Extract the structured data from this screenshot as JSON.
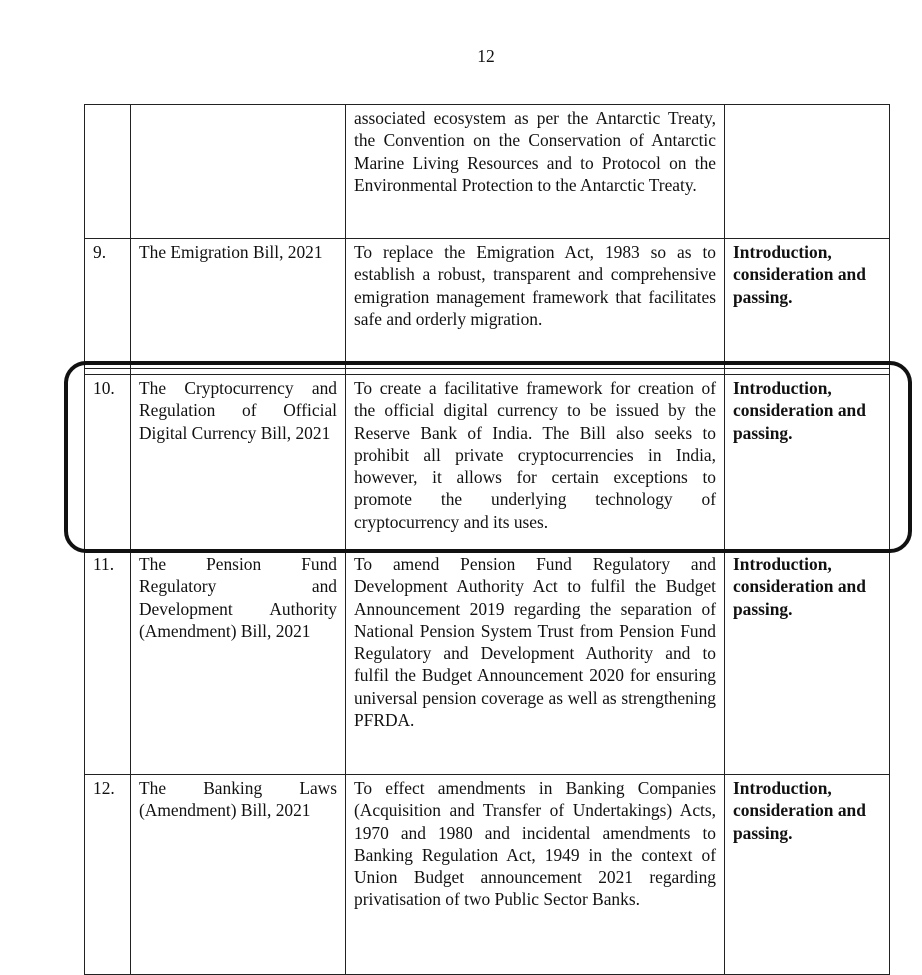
{
  "page_number": "12",
  "rows": [
    {
      "num": "",
      "bill": "",
      "purpose": "associated ecosystem as per the Antarctic Treaty, the Convention on the Conservation of Antarctic Marine Living Resources and to Protocol on the Environmental Protection to the Antarctic Treaty.",
      "action": ""
    },
    {
      "num": "9.",
      "bill": "The Emigration Bill, 2021",
      "purpose": "To replace the Emigration Act, 1983 so as to establish a robust, transparent and comprehensive emigration management framework that facilitates safe and orderly migration.",
      "action": "Introduction, consideration and passing."
    },
    {
      "num": "10.",
      "bill": "The Cryptocurrency and Regulation of Official Digital Currency Bill, 2021",
      "purpose": "To create a facilitative framework for creation of the official digital currency to be issued by the Reserve Bank of India. The Bill also seeks to prohibit all private cryptocurrencies in India, however, it allows for certain exceptions to promote the underlying technology of cryptocurrency and its uses.",
      "action": "Introduction, consideration and passing.",
      "highlighted": true
    },
    {
      "num": "11.",
      "bill": "The Pension Fund Regulatory and Development Authority (Amendment) Bill, 2021",
      "purpose": "To amend Pension Fund Regulatory and Development Authority Act to fulfil the Budget Announcement 2019 regarding the separation of National Pension System Trust from Pension Fund Regulatory and Development Authority and to fulfil the Budget Announcement 2020 for ensuring universal pension coverage as well as strengthening PFRDA.",
      "action": "Introduction, consideration and passing."
    },
    {
      "num": "12.",
      "bill": "The Banking Laws (Amendment) Bill, 2021",
      "purpose": "To effect amendments in Banking Companies (Acquisition and Transfer of Undertakings) Acts, 1970 and 1980 and incidental amendments to Banking Regulation Act, 1949 in the context of Union Budget announcement 2021 regarding privatisation of two Public Sector Banks.",
      "action": "Introduction, consideration and passing."
    }
  ],
  "highlight_color": "#111111"
}
